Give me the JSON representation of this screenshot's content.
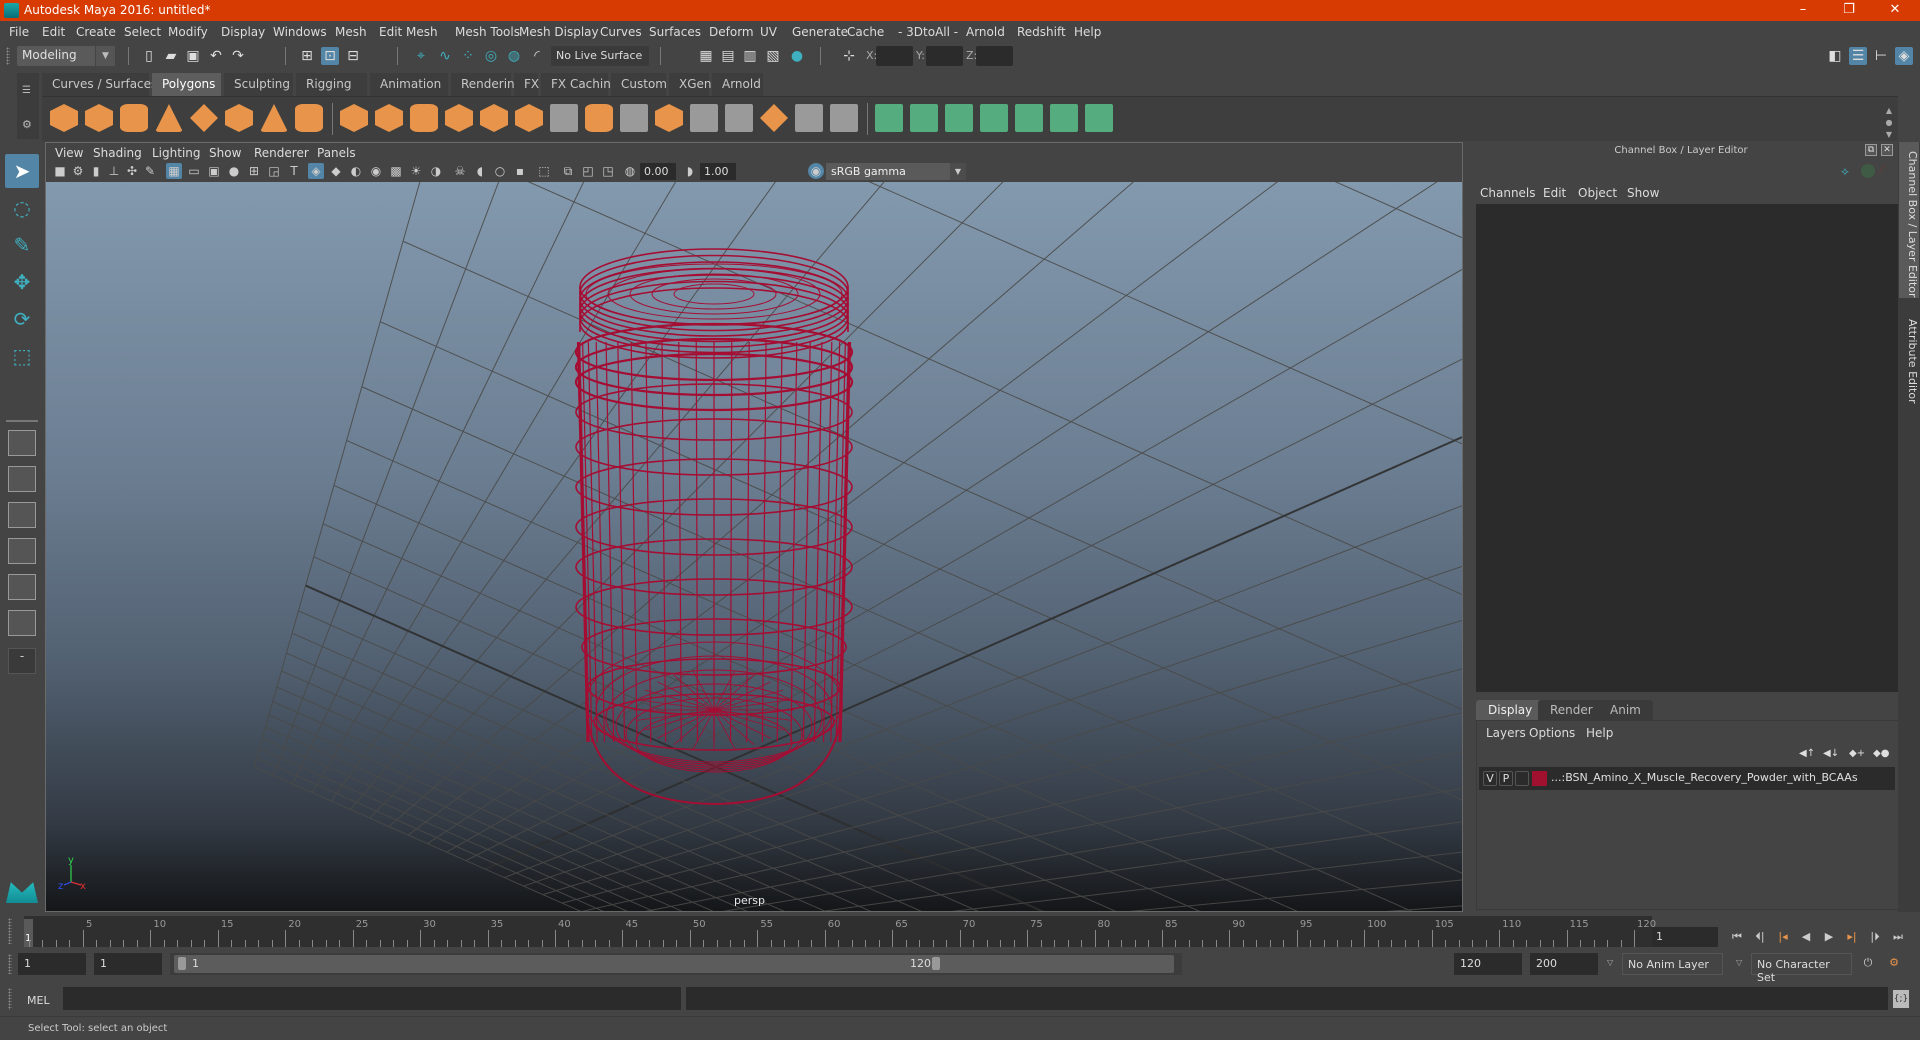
{
  "window": {
    "title": "Autodesk Maya 2016: untitled*",
    "controls": [
      "minimize",
      "maximize",
      "close"
    ]
  },
  "menubar": [
    "File",
    "Edit",
    "Create",
    "Select",
    "Modify",
    "Display",
    "Windows",
    "Mesh",
    "Edit Mesh",
    "Mesh Tools",
    "Mesh Display",
    "Curves",
    "Surfaces",
    "Deform",
    "UV",
    "Generate",
    "Cache",
    "- 3DtoAll -",
    "Arnold",
    "Redshift",
    "Help"
  ],
  "statusline": {
    "mode": "Modeling",
    "live_surface": "No Live Surface",
    "x_label": "X:",
    "y_label": "Y:",
    "z_label": "Z:",
    "x_value": "",
    "y_value": "",
    "z_value": ""
  },
  "shelf": {
    "tabs": [
      "Curves / Surfaces",
      "Polygons",
      "Sculpting",
      "Rigging",
      "Animation",
      "Rendering",
      "FX",
      "FX Caching",
      "Custom",
      "XGen",
      "Arnold"
    ],
    "active_tab": "Polygons",
    "icons": [
      {
        "name": "poly-sphere-icon",
        "style": "orange"
      },
      {
        "name": "poly-cube-icon",
        "style": "orange"
      },
      {
        "name": "poly-cylinder-icon",
        "style": "orange cyl"
      },
      {
        "name": "poly-cone-icon",
        "style": "orange cone"
      },
      {
        "name": "poly-plane-icon",
        "style": "orange diam"
      },
      {
        "name": "poly-torus-icon",
        "style": "orange"
      },
      {
        "name": "poly-pyramid-icon",
        "style": "orange cone"
      },
      {
        "name": "poly-pipe-icon",
        "style": "orange cyl"
      },
      {
        "name": "combine-icon",
        "style": "orange"
      },
      {
        "name": "separate-icon",
        "style": "orange"
      },
      {
        "name": "mirror-icon",
        "style": "orange cyl"
      },
      {
        "name": "smooth-icon",
        "style": "orange"
      },
      {
        "name": "boolean-icon",
        "style": "orange"
      },
      {
        "name": "reduce-icon",
        "style": "orange"
      },
      {
        "name": "multi-cut-icon",
        "style": "grey"
      },
      {
        "name": "extrude-icon",
        "style": "orange cyl"
      },
      {
        "name": "bridge-icon",
        "style": "grey"
      },
      {
        "name": "bevel-icon",
        "style": "orange"
      },
      {
        "name": "insert-edge-loop-icon",
        "style": "grey"
      },
      {
        "name": "offset-edge-loop-icon",
        "style": "grey"
      },
      {
        "name": "poke-icon",
        "style": "orange diam"
      },
      {
        "name": "wedge-icon",
        "style": "grey"
      },
      {
        "name": "append-polygon-icon",
        "style": "grey"
      },
      {
        "name": "planar-uv-icon",
        "style": "green"
      },
      {
        "name": "cylindrical-uv-icon",
        "style": "green"
      },
      {
        "name": "spherical-uv-icon",
        "style": "green"
      },
      {
        "name": "automatic-uv-icon",
        "style": "green"
      },
      {
        "name": "unfold-uv-icon",
        "style": "green"
      },
      {
        "name": "uv-editor-icon",
        "style": "green"
      },
      {
        "name": "cut-sew-uv-icon",
        "style": "green"
      }
    ]
  },
  "toolbox": {
    "tools": [
      {
        "name": "select-tool-icon",
        "glyph": "➤",
        "active": true
      },
      {
        "name": "lasso-select-icon",
        "glyph": "◌",
        "active": false
      },
      {
        "name": "paint-select-icon",
        "glyph": "✎",
        "active": false
      },
      {
        "name": "move-tool-icon",
        "glyph": "✥",
        "active": false
      },
      {
        "name": "rotate-tool-icon",
        "glyph": "⟳",
        "active": false
      },
      {
        "name": "scale-tool-icon",
        "glyph": "⬚",
        "active": false
      }
    ],
    "layouts": [
      "single-perspective-layout-icon",
      "four-view-layout-icon",
      "persp-outliner-layout-icon",
      "persp-graph-layout-icon",
      "persp-hypershade-layout-icon",
      "persp-graph-outliner-layout-icon"
    ],
    "more_label": "-"
  },
  "viewport": {
    "menu": [
      "View",
      "Shading",
      "Lighting",
      "Show",
      "Renderer",
      "Panels"
    ],
    "exposure": "0.00",
    "gamma": "1.00",
    "color_space": "sRGB gamma",
    "camera_label": "persp",
    "wire_color": "#a50d33",
    "axis": {
      "y": "y",
      "x": "x",
      "z": "z"
    }
  },
  "right_panel": {
    "title": "Channel Box / Layer Editor",
    "channel_menu": [
      "Channels",
      "Edit",
      "Object",
      "Show"
    ],
    "layer_tabs": [
      "Display",
      "Render",
      "Anim"
    ],
    "active_layer_tab": "Display",
    "layer_menu": [
      "Layers",
      "Options",
      "Help"
    ],
    "layers": [
      {
        "visible": "V",
        "playback": "P",
        "color": "#a0102f",
        "name": "...:BSN_Amino_X_Muscle_Recovery_Powder_with_BCAAs"
      }
    ],
    "side_tabs": [
      "Channel Box / Layer Editor",
      "Attribute Editor"
    ]
  },
  "timeline": {
    "ticks": [
      5,
      10,
      15,
      20,
      25,
      30,
      35,
      40,
      45,
      50,
      55,
      60,
      65,
      70,
      75,
      80,
      85,
      90,
      95,
      100,
      105,
      110,
      115,
      120
    ],
    "min": 1,
    "max": 120,
    "current_frame": "1",
    "current_frame_field": "1"
  },
  "range": {
    "start": "1",
    "playback_start": "1",
    "slider_start": "1",
    "slider_end": "120",
    "playback_end": "120",
    "end": "200",
    "anim_layer": "No Anim Layer",
    "character_set": "No Character Set"
  },
  "command_line": {
    "language": "MEL",
    "input": "",
    "output": ""
  },
  "help_line": "Select Tool: select an object"
}
